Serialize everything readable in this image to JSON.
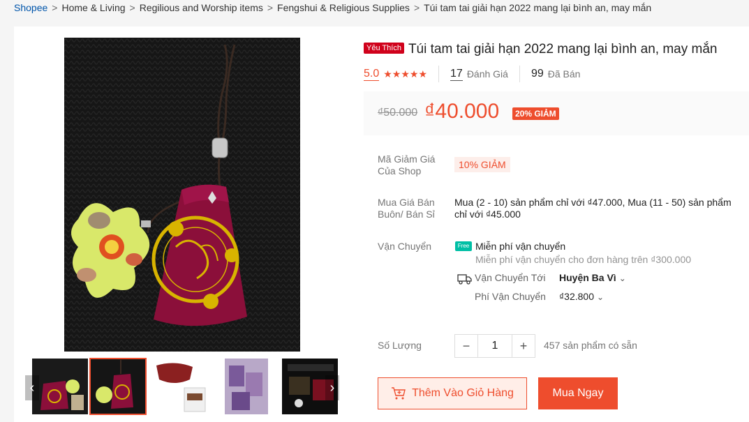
{
  "breadcrumb": [
    "Shopee",
    "Home & Living",
    "Regilious and Worship items",
    "Fengshui & Religious Supplies",
    "Túi tam tai giải hạn 2022 mang lại bình an, may mắn"
  ],
  "product": {
    "badge": "Yêu Thích",
    "title": "Túi tam tai giải hạn 2022 mang lại bình an, may mắn",
    "rating": "5.0",
    "stars": 5,
    "reviews_count": "17",
    "reviews_label": "Đánh Giá",
    "sold_count": "99",
    "sold_label": "Đã Bán",
    "old_price": "₫50.000",
    "price": "₫40.000",
    "discount": "20% GIẢM"
  },
  "voucher": {
    "label": "Mã Giảm Giá Của Shop",
    "tag": "10% GIẢM"
  },
  "wholesale": {
    "label": "Mua Giá Bán Buôn/ Bán Sỉ",
    "text": "Mua (2 - 10) sản phẩm chỉ với ₫47.000, Mua (11 - 50) sản phẩm chỉ với ₫45.000"
  },
  "shipping": {
    "label": "Vận Chuyển",
    "free_icon": "Free",
    "free_title": "Miễn phí vận chuyển",
    "free_sub": "Miễn phí vận chuyển cho đơn hàng trên ₫300.000",
    "to_label": "Vận Chuyển Tới",
    "to_value": "Huyện Ba Vì",
    "fee_label": "Phí Vận Chuyển",
    "fee_value": "₫32.800"
  },
  "quantity": {
    "label": "Số Lượng",
    "value": "1",
    "minus": "−",
    "plus": "+",
    "stock": "457 sản phẩm có sẵn"
  },
  "actions": {
    "add_to_cart": "Thêm Vào Giỏ Hàng",
    "buy_now": "Mua Ngay"
  },
  "gallery": {
    "thumb_count": 5,
    "active_index": 1,
    "prev": "‹",
    "next": "›"
  },
  "colors": {
    "accent": "#ee4d2d",
    "favorite": "#d0011b",
    "free_ship": "#00bfa5"
  }
}
